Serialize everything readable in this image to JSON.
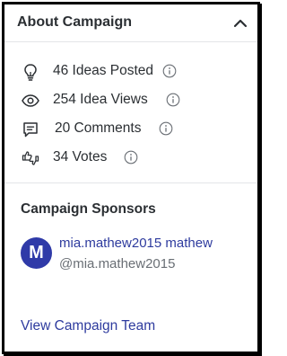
{
  "header": {
    "title": "About Campaign",
    "collapse_icon": "chevron-up-icon"
  },
  "stats": [
    {
      "icon": "lightbulb-icon",
      "label": "46 Ideas Posted"
    },
    {
      "icon": "eye-icon",
      "label": "254 Idea Views"
    },
    {
      "icon": "comment-icon",
      "label": "20 Comments"
    },
    {
      "icon": "thumbs-icon",
      "label": "34 Votes"
    }
  ],
  "sponsors": {
    "title": "Campaign Sponsors",
    "items": [
      {
        "avatar_letter": "M",
        "avatar_color": "#2f3aa8",
        "name": "mia.mathew2015 mathew",
        "handle": "@mia.mathew2015"
      }
    ]
  },
  "team_link": "View Campaign Team",
  "colors": {
    "link": "#2e3b9e",
    "text": "#2b2f33",
    "muted": "#6a6f75",
    "divider": "#e3e5e8"
  }
}
